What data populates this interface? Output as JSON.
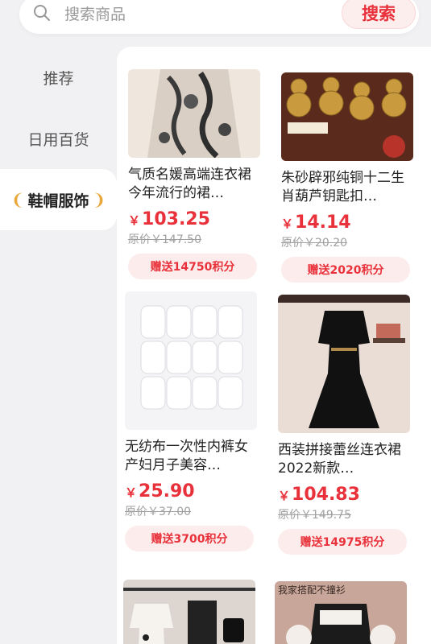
{
  "search": {
    "placeholder": "搜索商品",
    "button_label": "搜索"
  },
  "sidebar": {
    "items": [
      {
        "label": "推荐"
      },
      {
        "label": "日用百货"
      },
      {
        "label": "鞋帽服饰"
      }
    ]
  },
  "products": [
    {
      "title": "气质名媛高端连衣裙今年流行的裙…",
      "price": "103.25",
      "original": "原价￥147.50",
      "points": "赠送14750积分"
    },
    {
      "title": "朱砂辟邪纯铜十二生肖葫芦钥匙扣…",
      "price": "14.14",
      "original": "原价￥20.20",
      "points": "赠送2020积分"
    },
    {
      "title": "无纺布一次性内裤女产妇月子美容…",
      "price": "25.90",
      "original": "原价￥37.00",
      "points": "赠送3700积分"
    },
    {
      "title": "西装拼接蕾丝连衣裙2022新款…",
      "price": "104.83",
      "original": "原价￥149.75",
      "points": "赠送14975积分"
    }
  ],
  "currency_symbol": "￥",
  "thumb5_caption": "我家搭配不撞衫",
  "colors": {
    "accent": "#e8313a",
    "points_bg": "#fdecec",
    "laurel": "#e9a83a"
  }
}
